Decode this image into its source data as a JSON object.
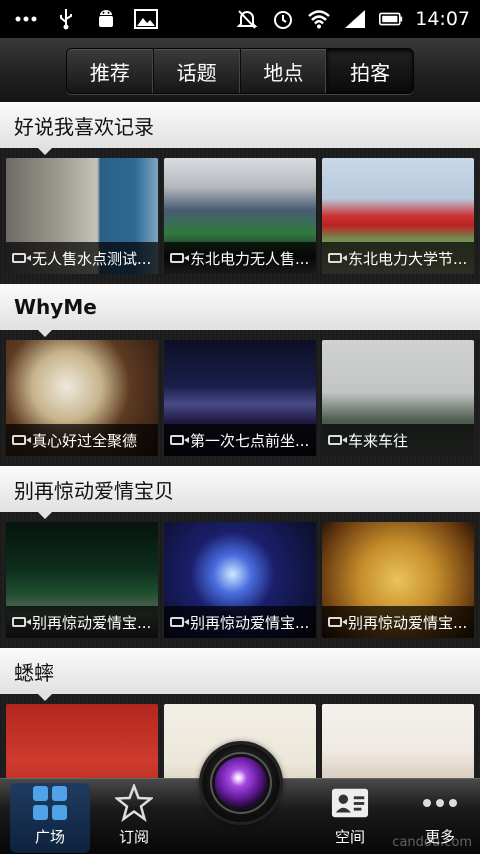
{
  "status_bar": {
    "time": "14:07"
  },
  "tabs": [
    {
      "label": "推荐",
      "active": false
    },
    {
      "label": "话题",
      "active": false
    },
    {
      "label": "地点",
      "active": false
    },
    {
      "label": "拍客",
      "active": true
    }
  ],
  "sections": [
    {
      "title": "好说我喜欢记录",
      "items": [
        "无人售水点测试...",
        "东北电力无人售...",
        "东北电力大学节..."
      ]
    },
    {
      "title": "WhyMe",
      "items": [
        "真心好过全聚德",
        "第一次七点前坐...",
        "车来车往"
      ]
    },
    {
      "title": "别再惊动爱情宝贝",
      "items": [
        "别再惊动爱情宝...",
        "别再惊动爱情宝...",
        "别再惊动爱情宝..."
      ]
    },
    {
      "title": "蟋蟀",
      "items": [
        "",
        "",
        ""
      ]
    }
  ],
  "bottom_nav": [
    {
      "label": "广场",
      "active": true
    },
    {
      "label": "订阅",
      "active": false
    },
    {
      "label": "空间",
      "active": false
    },
    {
      "label": "更多",
      "active": false
    }
  ],
  "watermark": "candou.com"
}
